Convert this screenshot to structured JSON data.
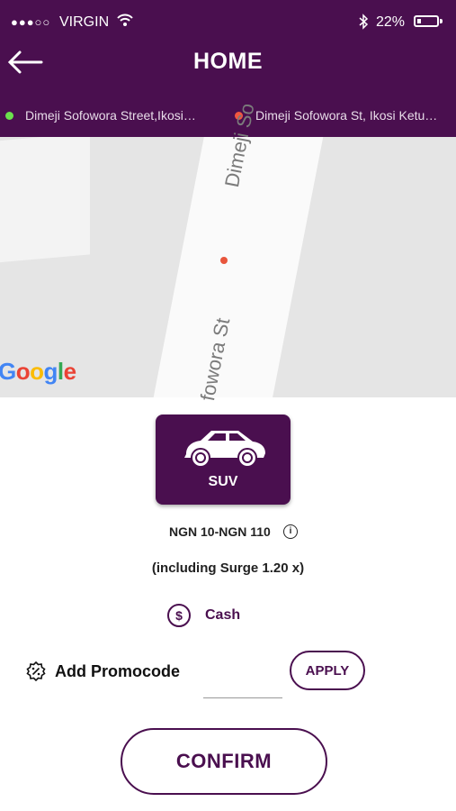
{
  "status_bar": {
    "signal": "●●●○○",
    "carrier": "VIRGIN",
    "battery": "22%",
    "battery_level": 0.22,
    "icons": [
      "wifi-icon",
      "bluetooth-icon",
      "battery-icon"
    ]
  },
  "header": {
    "title": "HOME",
    "back_icon": "arrow-left-icon",
    "background": "#4a0f4f"
  },
  "route": {
    "pickup": "Dimeji Sofowora Street,Ikosi…",
    "dropoff": "Dimeji Sofowora St, Ikosi Ketu…",
    "pickup_color": "#6be04d",
    "dropoff_color": "#f2573f"
  },
  "map": {
    "street_label_1": "Dimeji So",
    "street_label_2": "fowora St",
    "logo": "Google"
  },
  "vehicle": {
    "type": "SUV",
    "icon": "car-icon"
  },
  "fare": {
    "range": "NGN 10-NGN 110",
    "info_icon": "i",
    "surge": "(including Surge 1.20 x)"
  },
  "payment": {
    "icon": "$",
    "method": "Cash"
  },
  "promo": {
    "label": "Add Promocode",
    "value": "",
    "apply": "APPLY"
  },
  "confirm": "CONFIRM",
  "colors": {
    "accent": "#4a0f4f"
  }
}
